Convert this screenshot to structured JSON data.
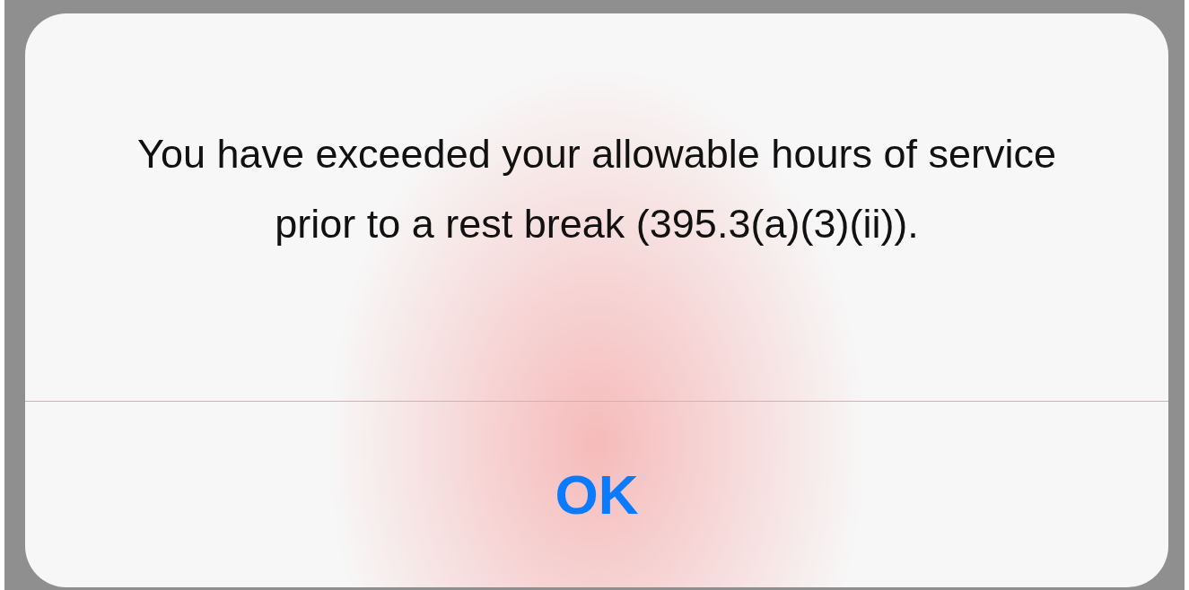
{
  "alert": {
    "message": "You have exceeded your allowable hours of service prior to a rest break (395.3(a)(3)(ii)).",
    "buttons": [
      {
        "label": "OK"
      }
    ]
  }
}
